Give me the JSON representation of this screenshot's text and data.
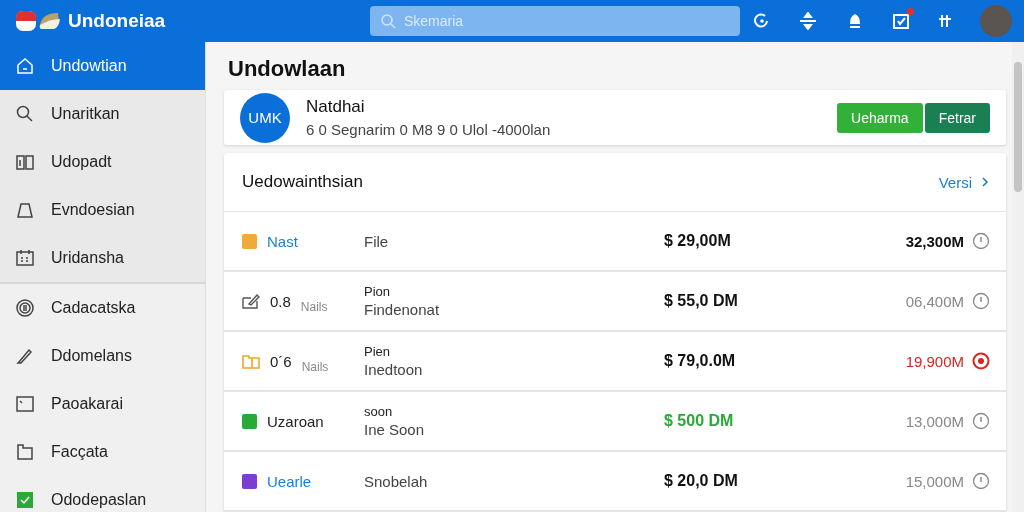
{
  "app": {
    "name": "Undoneiaa",
    "search_placeholder": "Skemaria",
    "notification_badge": true
  },
  "sidebar": {
    "groups": [
      [
        {
          "label": "Undowtian",
          "kind": "home",
          "selected": true
        },
        {
          "label": "Unaritkan",
          "kind": "search",
          "selected": false
        },
        {
          "label": "Udopadt",
          "kind": "book",
          "selected": false
        },
        {
          "label": "Evndoesian",
          "kind": "tag",
          "selected": false
        },
        {
          "label": "Uridansha",
          "kind": "calendar",
          "selected": false
        }
      ],
      [
        {
          "label": "Cadacatska",
          "kind": "coin",
          "selected": false
        },
        {
          "label": "Ddomelans",
          "kind": "pen",
          "selected": false
        },
        {
          "label": "Paoakarai",
          "kind": "screen",
          "selected": false
        },
        {
          "label": "Facçata",
          "kind": "folder",
          "selected": false
        },
        {
          "label": "Ododepaslan",
          "kind": "check",
          "selected": false
        }
      ]
    ]
  },
  "page_title": "Undowlaan",
  "profile": {
    "initials": "UMK",
    "name": "Natdhai",
    "details": "6 0 Segnarim 0 M8 9 0 Ulol -4000lan",
    "buttons": [
      {
        "label": "Ueharma",
        "kind": "primary"
      },
      {
        "label": "Fetrar",
        "kind": "secondary"
      }
    ]
  },
  "list": {
    "title": "Uedowainthsian",
    "link": "Versi",
    "rows": [
      {
        "kind": "square",
        "color": "#f2a93b",
        "name": "Nast",
        "link": true,
        "lines": [
          "File"
        ],
        "amount": "$ 29,00M",
        "positive": false,
        "total": "32,300M",
        "warning": false,
        "highlighted": true
      },
      {
        "kind": "edit",
        "name": "0.8",
        "sub": "Nails",
        "link": false,
        "lines": [
          "Pion",
          "Findenonat"
        ],
        "amount": "$ 55,0 DM",
        "positive": false,
        "total": "06,400M",
        "warning": false,
        "highlighted": false
      },
      {
        "kind": "folder",
        "name": "0´6",
        "sub": "Nails",
        "link": false,
        "lines": [
          "Pien",
          "Inedtoon"
        ],
        "amount": "$ 79,0.0M",
        "positive": false,
        "total": "19,900M",
        "warning": true,
        "highlighted": false
      },
      {
        "kind": "square",
        "color": "#2aa838",
        "name": "Uzaroan",
        "link": false,
        "lines": [
          "soon",
          "Ine Soon"
        ],
        "amount": "$ 500 DM",
        "positive": true,
        "total": "13,000M",
        "warning": false,
        "highlighted": false
      },
      {
        "kind": "square",
        "color": "#7b3fd0",
        "name": "Uearle",
        "link": true,
        "lines": [
          "Snobelah"
        ],
        "amount": "$ 20,0 DM",
        "positive": false,
        "total": "15,000M",
        "warning": false,
        "highlighted": false
      }
    ]
  }
}
